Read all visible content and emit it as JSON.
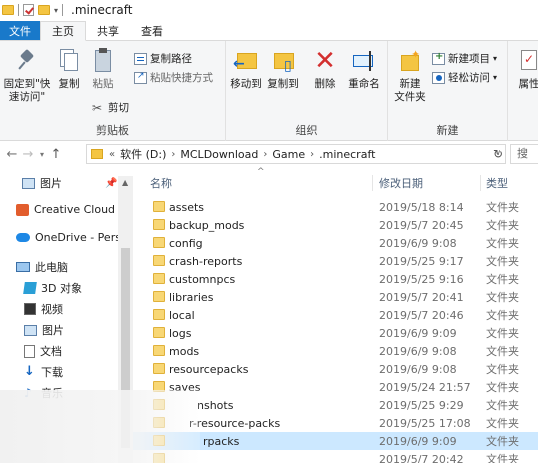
{
  "window": {
    "title": ".minecraft"
  },
  "tabs": [
    {
      "label": "文件"
    },
    {
      "label": "主页"
    },
    {
      "label": "共享"
    },
    {
      "label": "查看"
    }
  ],
  "ribbon": {
    "clipboard": {
      "pin_label_1": "固定到\"快",
      "pin_label_2": "速访问\"",
      "copy_label": "复制",
      "paste_label": "粘贴",
      "copy_path_label": "复制路径",
      "paste_shortcut_label": "粘贴快捷方式",
      "cut_label": "剪切",
      "group_label": "剪贴板"
    },
    "organize": {
      "move_to_label": "移动到",
      "copy_to_label": "复制到",
      "delete_label": "删除",
      "rename_label": "重命名",
      "group_label": "组织"
    },
    "new": {
      "new_folder_label_1": "新建",
      "new_folder_label_2": "文件夹",
      "new_item_label": "新建项目",
      "easy_access_label": "轻松访问",
      "group_label": "新建"
    },
    "open": {
      "properties_label": "属性"
    }
  },
  "address": {
    "prefix": "«",
    "segments": [
      "软件 (D:)",
      "MCLDownload",
      "Game",
      ".minecraft"
    ],
    "search_placeholder": "搜"
  },
  "nav_pane": {
    "items": [
      {
        "label": "图片",
        "icon": "pictures-icon",
        "pinned": true
      },
      {
        "label": "Creative Cloud F",
        "icon": "creative-cloud-icon"
      },
      {
        "label": "OneDrive - Pers",
        "icon": "onedrive-icon"
      },
      {
        "label": "此电脑",
        "icon": "this-pc-icon"
      },
      {
        "label": "3D 对象",
        "icon": "3d-objects-icon"
      },
      {
        "label": "视频",
        "icon": "videos-icon"
      },
      {
        "label": "图片",
        "icon": "pictures-icon"
      },
      {
        "label": "文档",
        "icon": "documents-icon"
      },
      {
        "label": "下载",
        "icon": "downloads-icon"
      },
      {
        "label": "音乐",
        "icon": "music-icon"
      }
    ]
  },
  "file_list": {
    "columns": {
      "name": "名称",
      "date": "修改日期",
      "type": "类型"
    },
    "rows": [
      {
        "name": "assets",
        "date": "2019/5/18 8:14",
        "type": "文件夹"
      },
      {
        "name": "backup_mods",
        "date": "2019/5/7 20:45",
        "type": "文件夹"
      },
      {
        "name": "config",
        "date": "2019/6/9 9:08",
        "type": "文件夹"
      },
      {
        "name": "crash-reports",
        "date": "2019/5/25 9:17",
        "type": "文件夹"
      },
      {
        "name": "customnpcs",
        "date": "2019/5/25 9:16",
        "type": "文件夹"
      },
      {
        "name": "libraries",
        "date": "2019/5/7 20:41",
        "type": "文件夹"
      },
      {
        "name": "local",
        "date": "2019/5/7 20:46",
        "type": "文件夹"
      },
      {
        "name": "logs",
        "date": "2019/6/9 9:09",
        "type": "文件夹"
      },
      {
        "name": "mods",
        "date": "2019/6/9 9:08",
        "type": "文件夹"
      },
      {
        "name": "resourcepacks",
        "date": "2019/6/9 9:08",
        "type": "文件夹"
      },
      {
        "name": "saves",
        "date": "2019/5/24 21:57",
        "type": "文件夹"
      },
      {
        "name": "nshots",
        "date": "2019/5/25 9:29",
        "type": "文件夹"
      },
      {
        "name": "r-resource-packs",
        "date": "2019/5/25 17:08",
        "type": "文件夹"
      },
      {
        "name": "rpacks",
        "date": "2019/6/9 9:09",
        "type": "文件夹",
        "selected": true
      },
      {
        "name": "",
        "date": "2019/5/7 20:42",
        "type": "文件夹"
      }
    ]
  }
}
